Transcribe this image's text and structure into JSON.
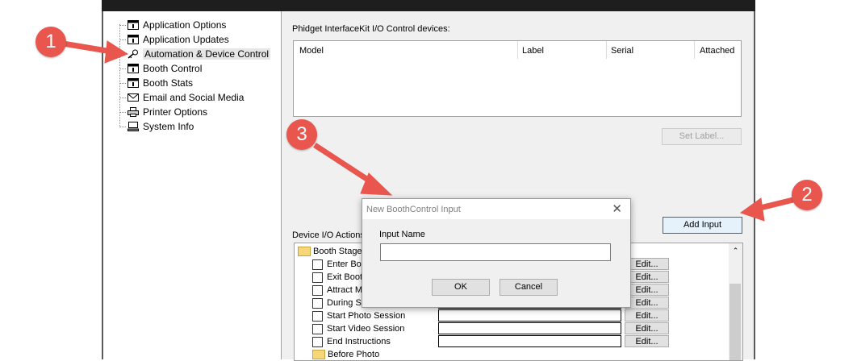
{
  "nav": {
    "items": [
      {
        "label": "Application Options",
        "icon": "window-icon"
      },
      {
        "label": "Application Updates",
        "icon": "window-icon"
      },
      {
        "label": "Automation & Device Control",
        "icon": "key-icon"
      },
      {
        "label": "Booth Control",
        "icon": "window-icon"
      },
      {
        "label": "Booth Stats",
        "icon": "window-icon"
      },
      {
        "label": "Email and Social Media",
        "icon": "envelope-icon"
      },
      {
        "label": "Printer Options",
        "icon": "printer-icon"
      },
      {
        "label": "System Info",
        "icon": "computer-icon"
      }
    ]
  },
  "devices": {
    "title": "Phidget InterfaceKit I/O Control devices:",
    "columns": [
      "Model",
      "Label",
      "Serial",
      "Attached"
    ],
    "set_label_button": "Set Label...",
    "add_input_button": "Add Input"
  },
  "io": {
    "title": "Device I/O Actions",
    "group1": "Booth Stages",
    "rows": [
      "Enter Boo",
      "Exit Booth",
      "Attract M",
      "During St",
      "Start Photo Session",
      "Start Video Session",
      "End Instructions"
    ],
    "edit_label": "Edit...",
    "group2": "Before Photo"
  },
  "dialog": {
    "title": "New BoothControl Input",
    "field_label": "Input Name",
    "field_value": "",
    "ok_button": "OK",
    "cancel_button": "Cancel"
  },
  "annotations": {
    "badge1": "1",
    "badge2": "2",
    "badge3": "3"
  },
  "colors": {
    "annotation": "#e8564e",
    "focus_border": "#0078d7"
  }
}
